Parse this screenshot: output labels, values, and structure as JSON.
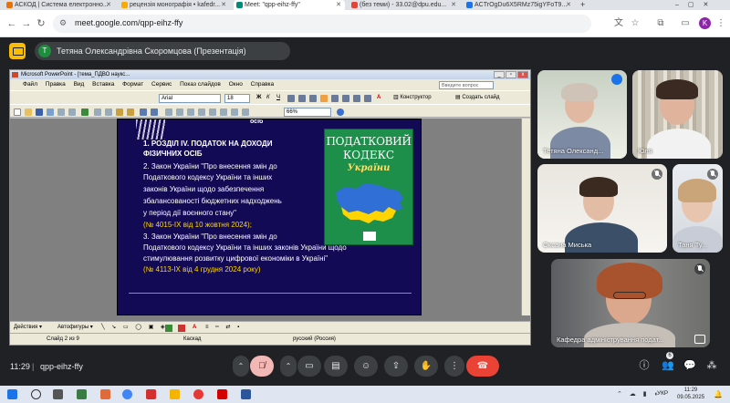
{
  "browser": {
    "tabs": [
      {
        "label": "АСКОД | Система електронно...",
        "color": "#e8710a",
        "active": false
      },
      {
        "label": "рецензія монографія • kafedr...",
        "color": "#f9ab00",
        "active": false
      },
      {
        "label": "Meet: \"qpp-eihz-ffy\"",
        "color": "#00897b",
        "active": true
      },
      {
        "label": "(без теми) - 33.02@dpu.edu...",
        "color": "#ea4335",
        "active": false
      },
      {
        "label": "ACTrOgDu6X5RMz75igYFoT9...",
        "color": "#1a73e8",
        "active": false
      }
    ],
    "url": "meet.google.com/qpp-eihz-ffy",
    "profile_initial": "K"
  },
  "meet": {
    "presenter_initial": "Т",
    "presenter_label": "Тетяна Олександрівна Скоромцова (Презентація)",
    "time": "11:29",
    "separator": "|",
    "meeting_code": "qpp-eihz-ffy",
    "participants_count": "6"
  },
  "powerpoint": {
    "title": "Microsoft PowerPoint - [тема_ПДВО наукс...",
    "menu": [
      "Файл",
      "Правка",
      "Вид",
      "Вставка",
      "Формат",
      "Сервис",
      "Показ слайдов",
      "Окно",
      "Справка"
    ],
    "help_placeholder": "Введите вопрос",
    "font_name": "Arial",
    "font_size": "18",
    "zoom": "66%",
    "constructor_label": "Конструктор",
    "new_slide_label": "Создать слайд",
    "draw_actions": "Действия ▾",
    "draw_autoshapes": "Автофигуры ▾",
    "status": {
      "slide": "Слайд 2 из 9",
      "theme": "Каскад",
      "language": "русский (Россия)"
    },
    "slide": {
      "top_fragment": "осіб",
      "lines": [
        "1. РОЗДІЛ IV. ПОДАТОК НА ДОХОДИ",
        "ФІЗИЧНИХ ОСІБ",
        "2. Закон України \"Про внесення змін до",
        " Податкового кодексу України та інших",
        " законів України щодо забезпечення",
        " збалансованості бюджетних надходжень",
        "у період дії воєнного стану\"",
        " (№ 4015-ІХ від 10 жовтня  2024);",
        "3. Закон України \"Про внесення змін до",
        "Податкового кодексу України та інших законів України щодо",
        "стимулювання розвитку цифрової економіки в Україні\"",
        " (№ 4113-ІХ від 4 грудня 2024 року)"
      ],
      "book_line1": "ПОДАТКОВИЙ",
      "book_line2": "КОДЕКС",
      "book_line3": "України"
    }
  },
  "participants": [
    {
      "name": "Тетяна Олександ...",
      "muted": false
    },
    {
      "name": "Юля",
      "muted": false
    },
    {
      "name": "Оксана Миська",
      "muted": true
    },
    {
      "name": "Таня Ту...",
      "muted": true
    },
    {
      "name": "Кафедра адміністрування подат...",
      "muted": true
    }
  ],
  "taskbar": {
    "lang": "УКР",
    "time": "11:29",
    "date": "09.05.2025"
  }
}
